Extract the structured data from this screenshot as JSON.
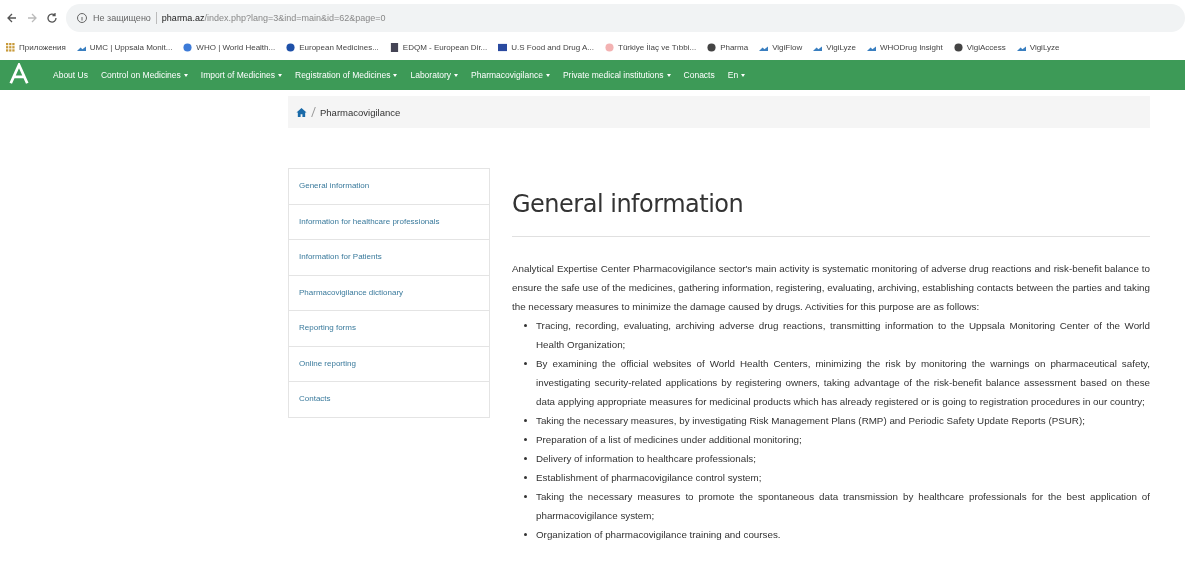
{
  "browser": {
    "security": "Не защищено",
    "host": "pharma.az",
    "path": "/index.php?lang=3&ind=main&id=62&page=0",
    "bookmarks": [
      {
        "label": "Приложения",
        "kind": "apps"
      },
      {
        "label": "UMC | Uppsala Monit...",
        "kind": "wave"
      },
      {
        "label": "WHO | World Health...",
        "kind": "globe"
      },
      {
        "label": "European Medicines...",
        "kind": "dot"
      },
      {
        "label": "EDQM - European Dir...",
        "kind": "square"
      },
      {
        "label": "U.S Food and Drug A...",
        "kind": "flag"
      },
      {
        "label": "Türkiye İlaç ve Tıbbi...",
        "kind": "seal"
      },
      {
        "label": "Pharma",
        "kind": "world"
      },
      {
        "label": "VigiFlow",
        "kind": "wave"
      },
      {
        "label": "VigiLyze",
        "kind": "wave"
      },
      {
        "label": "WHODrug Insight",
        "kind": "wave"
      },
      {
        "label": "VigiAccess",
        "kind": "world"
      },
      {
        "label": "VigiLyze",
        "kind": "wave"
      }
    ]
  },
  "nav": {
    "items": [
      {
        "label": "About Us",
        "dropdown": false
      },
      {
        "label": "Control on Medicines",
        "dropdown": true
      },
      {
        "label": "Import of Medicines",
        "dropdown": true
      },
      {
        "label": "Registration of Medicines",
        "dropdown": true
      },
      {
        "label": "Laboratory",
        "dropdown": true
      },
      {
        "label": "Pharmacovigilance",
        "dropdown": true
      },
      {
        "label": "Private medical institutions",
        "dropdown": true
      },
      {
        "label": "Conacts",
        "dropdown": false
      },
      {
        "label": "En",
        "dropdown": true
      }
    ]
  },
  "breadcrumb": {
    "current": "Pharmacovigilance"
  },
  "sidebar": {
    "items": [
      "General information",
      "Information for healthcare professionals",
      "Information for Patients",
      "Pharmacovigilance dictionary",
      "Reporting forms",
      "Online reporting",
      "Contacts"
    ]
  },
  "content": {
    "title": "General information",
    "intro": "Analytical Expertise Center Pharmacovigilance sector's main activity is systematic monitoring of adverse drug reactions and risk-benefit balance to ensure the safe use of the medicines, gathering information, registering, evaluating, archiving, establishing contacts between the parties and taking the necessary measures to minimize the damage caused by drugs. Activities for this purpose are as follows:",
    "bullets": [
      "Tracing, recording, evaluating, archiving adverse drug reactions, transmitting information to the Uppsala Monitoring Center of the World Health Organization;",
      "By examining the official websites of World Health Centers, minimizing the risk by monitoring the warnings on pharmaceutical safety, investigating security-related applications by registering owners, taking advantage of the risk-benefit balance assessment based on these data applying appropriate measures for medicinal products which has already registered or is going to registration procedures in our country;",
      "Taking the necessary measures, by investigating Risk Management Plans (RMP) and Periodic Safety Update Reports (PSUR);",
      "Preparation of a list of medicines under additional monitoring;",
      "Delivery of information to healthcare professionals;",
      "Establishment of pharmacovigilance control system;",
      "Taking the necessary measures to promote the spontaneous data transmission by healthcare professionals for the best application of pharmacovigilance system;",
      "Organization of pharmacovigilance training and courses."
    ]
  }
}
